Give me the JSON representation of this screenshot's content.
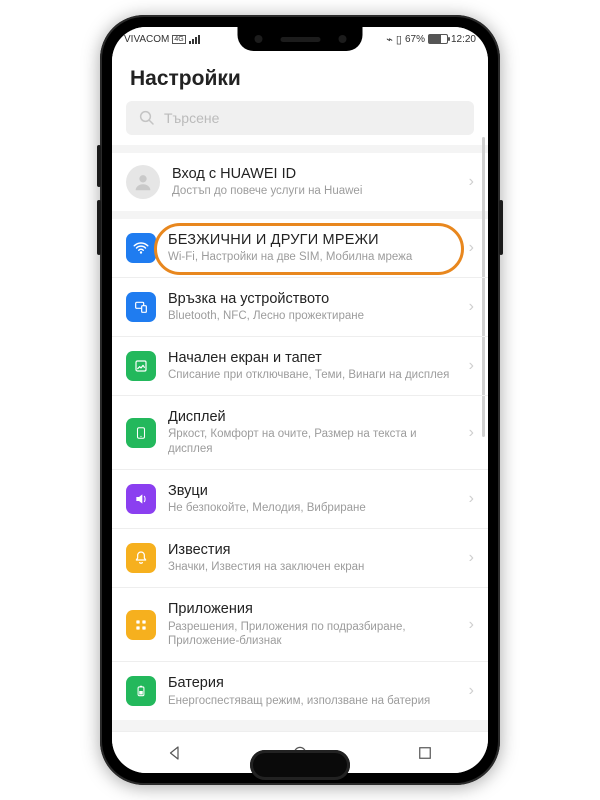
{
  "status": {
    "carrier": "VIVACOM",
    "net_badge": "4G",
    "battery_pct": "67%",
    "time": "12:20"
  },
  "header": {
    "title": "Настройки"
  },
  "search": {
    "placeholder": "Търсене"
  },
  "account": {
    "title": "Вход с HUAWEI ID",
    "sub": "Достъп до повече услуги на Huawei"
  },
  "items": [
    {
      "key": "wireless",
      "title": "БЕЗЖИЧНИ И ДРУГИ МРЕЖИ",
      "sub": "Wi-Fi, Настройки на две SIM, Мобилна мрежа",
      "color": "#1f7cf0"
    },
    {
      "key": "device-conn",
      "title": "Връзка на устройството",
      "sub": "Bluetooth, NFC, Лесно прожектиране",
      "color": "#1f7cf0"
    },
    {
      "key": "home-wall",
      "title": "Начален екран и тапет",
      "sub": "Списание при отключване, Теми, Винаги на дисплея",
      "color": "#23b85c"
    },
    {
      "key": "display",
      "title": "Дисплей",
      "sub": "Яркост, Комфорт на очите, Размер на текста и дисплея",
      "color": "#23b85c"
    },
    {
      "key": "sounds",
      "title": "Звуци",
      "sub": "Не безпокойте, Мелодия, Вибриране",
      "color": "#8b3ff0"
    },
    {
      "key": "notifications",
      "title": "Известия",
      "sub": "Значки, Известия на заключен екран",
      "color": "#f6b01e"
    },
    {
      "key": "apps",
      "title": "Приложения",
      "sub": "Разрешения, Приложения по подразбиране, Приложение-близнак",
      "color": "#f6b01e"
    },
    {
      "key": "battery",
      "title": "Батерия",
      "sub": "Енергоспестяващ режим, използване на батерия",
      "color": "#23b85c"
    }
  ],
  "colors": {
    "highlight": "#e8871e"
  }
}
